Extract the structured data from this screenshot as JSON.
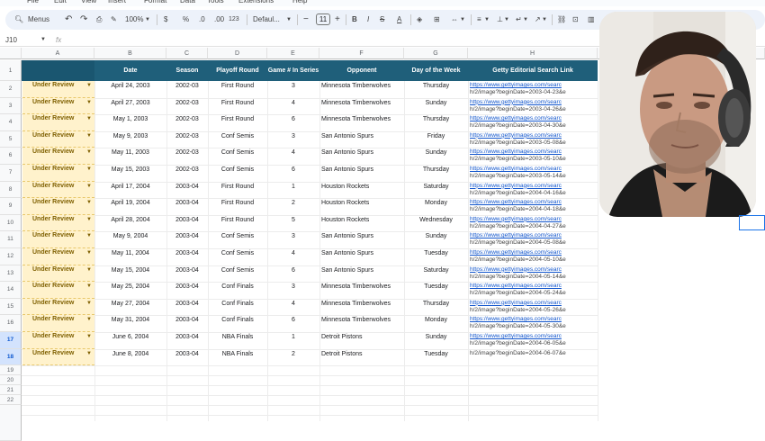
{
  "menu": [
    "File",
    "Edit",
    "View",
    "Insert",
    "Format",
    "Data",
    "Tools",
    "Extensions",
    "Help"
  ],
  "toolbar": {
    "menus_label": "Menus",
    "zoom": "100%",
    "currency": "$",
    "percent": "%",
    "dec_dec": ".0",
    "dec_inc": ".00",
    "number_format": "123",
    "font": "Defaul...",
    "font_size": "11"
  },
  "name_box": "J10",
  "fx": "fx",
  "columns": [
    "A",
    "B",
    "C",
    "D",
    "E",
    "F",
    "G",
    "H"
  ],
  "headers": {
    "b": "Date",
    "c": "Season",
    "d": "Playoff Round",
    "e": "Game # In Series",
    "f": "Opponent",
    "g": "Day of the Week",
    "h": "Getty Editorial Search Link"
  },
  "rows": [
    {
      "status": "Under Review",
      "date": "April 24, 2003",
      "season": "2002-03",
      "round": "First Round",
      "game": "3",
      "opponent": "Minnesota Timberwolves",
      "day": "Thursday",
      "link1": "https://www.gettyimages.com/searc",
      "link2": "h/2/image?beginDate=2003-04-23&e"
    },
    {
      "status": "Under Review",
      "date": "April 27, 2003",
      "season": "2002-03",
      "round": "First Round",
      "game": "4",
      "opponent": "Minnesota Timberwolves",
      "day": "Sunday",
      "link1": "https://www.gettyimages.com/searc",
      "link2": "h/2/image?beginDate=2003-04-26&e"
    },
    {
      "status": "Under Review",
      "date": "May 1, 2003",
      "season": "2002-03",
      "round": "First Round",
      "game": "6",
      "opponent": "Minnesota Timberwolves",
      "day": "Thursday",
      "link1": "https://www.gettyimages.com/searc",
      "link2": "h/2/image?beginDate=2003-04-30&e"
    },
    {
      "status": "Under Review",
      "date": "May 9, 2003",
      "season": "2002-03",
      "round": "Conf Semis",
      "game": "3",
      "opponent": "San Antonio Spurs",
      "day": "Friday",
      "link1": "https://www.gettyimages.com/searc",
      "link2": "h/2/image?beginDate=2003-05-08&e"
    },
    {
      "status": "Under Review",
      "date": "May 11, 2003",
      "season": "2002-03",
      "round": "Conf Semis",
      "game": "4",
      "opponent": "San Antonio Spurs",
      "day": "Sunday",
      "link1": "https://www.gettyimages.com/searc",
      "link2": "h/2/image?beginDate=2003-05-10&e"
    },
    {
      "status": "Under Review",
      "date": "May 15, 2003",
      "season": "2002-03",
      "round": "Conf Semis",
      "game": "6",
      "opponent": "San Antonio Spurs",
      "day": "Thursday",
      "link1": "https://www.gettyimages.com/searc",
      "link2": "h/2/image?beginDate=2003-05-14&e"
    },
    {
      "status": "Under Review",
      "date": "April 17, 2004",
      "season": "2003-04",
      "round": "First Round",
      "game": "1",
      "opponent": "Houston Rockets",
      "day": "Saturday",
      "link1": "https://www.gettyimages.com/searc",
      "link2": "h/2/image?beginDate=2004-04-16&e"
    },
    {
      "status": "Under Review",
      "date": "April 19, 2004",
      "season": "2003-04",
      "round": "First Round",
      "game": "2",
      "opponent": "Houston Rockets",
      "day": "Monday",
      "link1": "https://www.gettyimages.com/searc",
      "link2": "h/2/image?beginDate=2004-04-18&e"
    },
    {
      "status": "Under Review",
      "date": "April 28, 2004",
      "season": "2003-04",
      "round": "First Round",
      "game": "5",
      "opponent": "Houston Rockets",
      "day": "Wednesday",
      "link1": "https://www.gettyimages.com/searc",
      "link2": "h/2/image?beginDate=2004-04-27&e"
    },
    {
      "status": "Under Review",
      "date": "May 9, 2004",
      "season": "2003-04",
      "round": "Conf Semis",
      "game": "3",
      "opponent": "San Antonio Spurs",
      "day": "Sunday",
      "link1": "https://www.gettyimages.com/searc",
      "link2": "h/2/image?beginDate=2004-05-08&e"
    },
    {
      "status": "Under Review",
      "date": "May 11, 2004",
      "season": "2003-04",
      "round": "Conf Semis",
      "game": "4",
      "opponent": "San Antonio Spurs",
      "day": "Tuesday",
      "link1": "https://www.gettyimages.com/searc",
      "link2": "h/2/image?beginDate=2004-05-10&e"
    },
    {
      "status": "Under Review",
      "date": "May 15, 2004",
      "season": "2003-04",
      "round": "Conf Semis",
      "game": "6",
      "opponent": "San Antonio Spurs",
      "day": "Saturday",
      "link1": "https://www.gettyimages.com/searc",
      "link2": "h/2/image?beginDate=2004-05-14&e"
    },
    {
      "status": "Under Review",
      "date": "May 25, 2004",
      "season": "2003-04",
      "round": "Conf Finals",
      "game": "3",
      "opponent": "Minnesota Timberwolves",
      "day": "Tuesday",
      "link1": "https://www.gettyimages.com/searc",
      "link2": "h/2/image?beginDate=2004-05-24&e"
    },
    {
      "status": "Under Review",
      "date": "May 27, 2004",
      "season": "2003-04",
      "round": "Conf Finals",
      "game": "4",
      "opponent": "Minnesota Timberwolves",
      "day": "Thursday",
      "link1": "https://www.gettyimages.com/searc",
      "link2": "h/2/image?beginDate=2004-05-26&e"
    },
    {
      "status": "Under Review",
      "date": "May 31, 2004",
      "season": "2003-04",
      "round": "Conf Finals",
      "game": "6",
      "opponent": "Minnesota Timberwolves",
      "day": "Monday",
      "link1": "https://www.gettyimages.com/searc",
      "link2": "h/2/image?beginDate=2004-05-30&e"
    },
    {
      "status": "Under Review",
      "date": "June 6, 2004",
      "season": "2003-04",
      "round": "NBA Finals",
      "game": "1",
      "opponent": "Detroit Pistons",
      "day": "Sunday",
      "link1": "https://www.gettyimages.com/searc",
      "link2": "h/2/image?beginDate=2004-06-05&e"
    },
    {
      "status": "Under Review",
      "date": "June 8, 2004",
      "season": "2003-04",
      "round": "NBA Finals",
      "game": "2",
      "opponent": "Detroit Pistons",
      "day": "Tuesday",
      "link1": "",
      "link2": "h/2/image?beginDate=2004-06-07&e"
    }
  ],
  "row_numbers": [
    "1",
    "2",
    "3",
    "4",
    "5",
    "6",
    "7",
    "8",
    "9",
    "10",
    "11",
    "12",
    "13",
    "14",
    "15",
    "16",
    "17",
    "18",
    "19",
    "20",
    "21",
    "22"
  ],
  "colors": {
    "header_bg": "#1f5f7a",
    "status_bg": "#fff2cc",
    "status_text": "#7f6000"
  }
}
